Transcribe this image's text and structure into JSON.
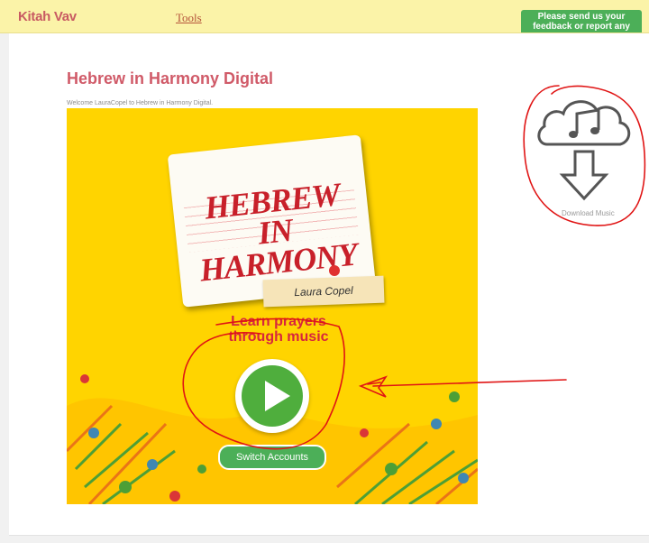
{
  "header": {
    "brand": "Kitah Vav",
    "tools_link": "Tools",
    "feedback_button": "Please send us your feedback or report any"
  },
  "main": {
    "title": "Hebrew in Harmony Digital",
    "welcome": "Welcome LauraCopel to Hebrew in Harmony Digital.",
    "hero": {
      "logo_text": "HEBREW IN HARMONY",
      "name_tag": "Laura Copel",
      "tagline_line1": "Learn prayers",
      "tagline_line2": "through music",
      "switch_accounts": "Switch Accounts"
    }
  },
  "sidebar": {
    "download_label": "Download Music"
  },
  "colors": {
    "brand": "#c85a62",
    "topbar_bg": "#fbf3a8",
    "hero_bg": "#ffd400",
    "green": "#4caf58",
    "annotation": "#e01414"
  },
  "icons": [
    "cloud-music-icon",
    "download-arrow-icon",
    "play-icon",
    "pushpin-icon"
  ]
}
